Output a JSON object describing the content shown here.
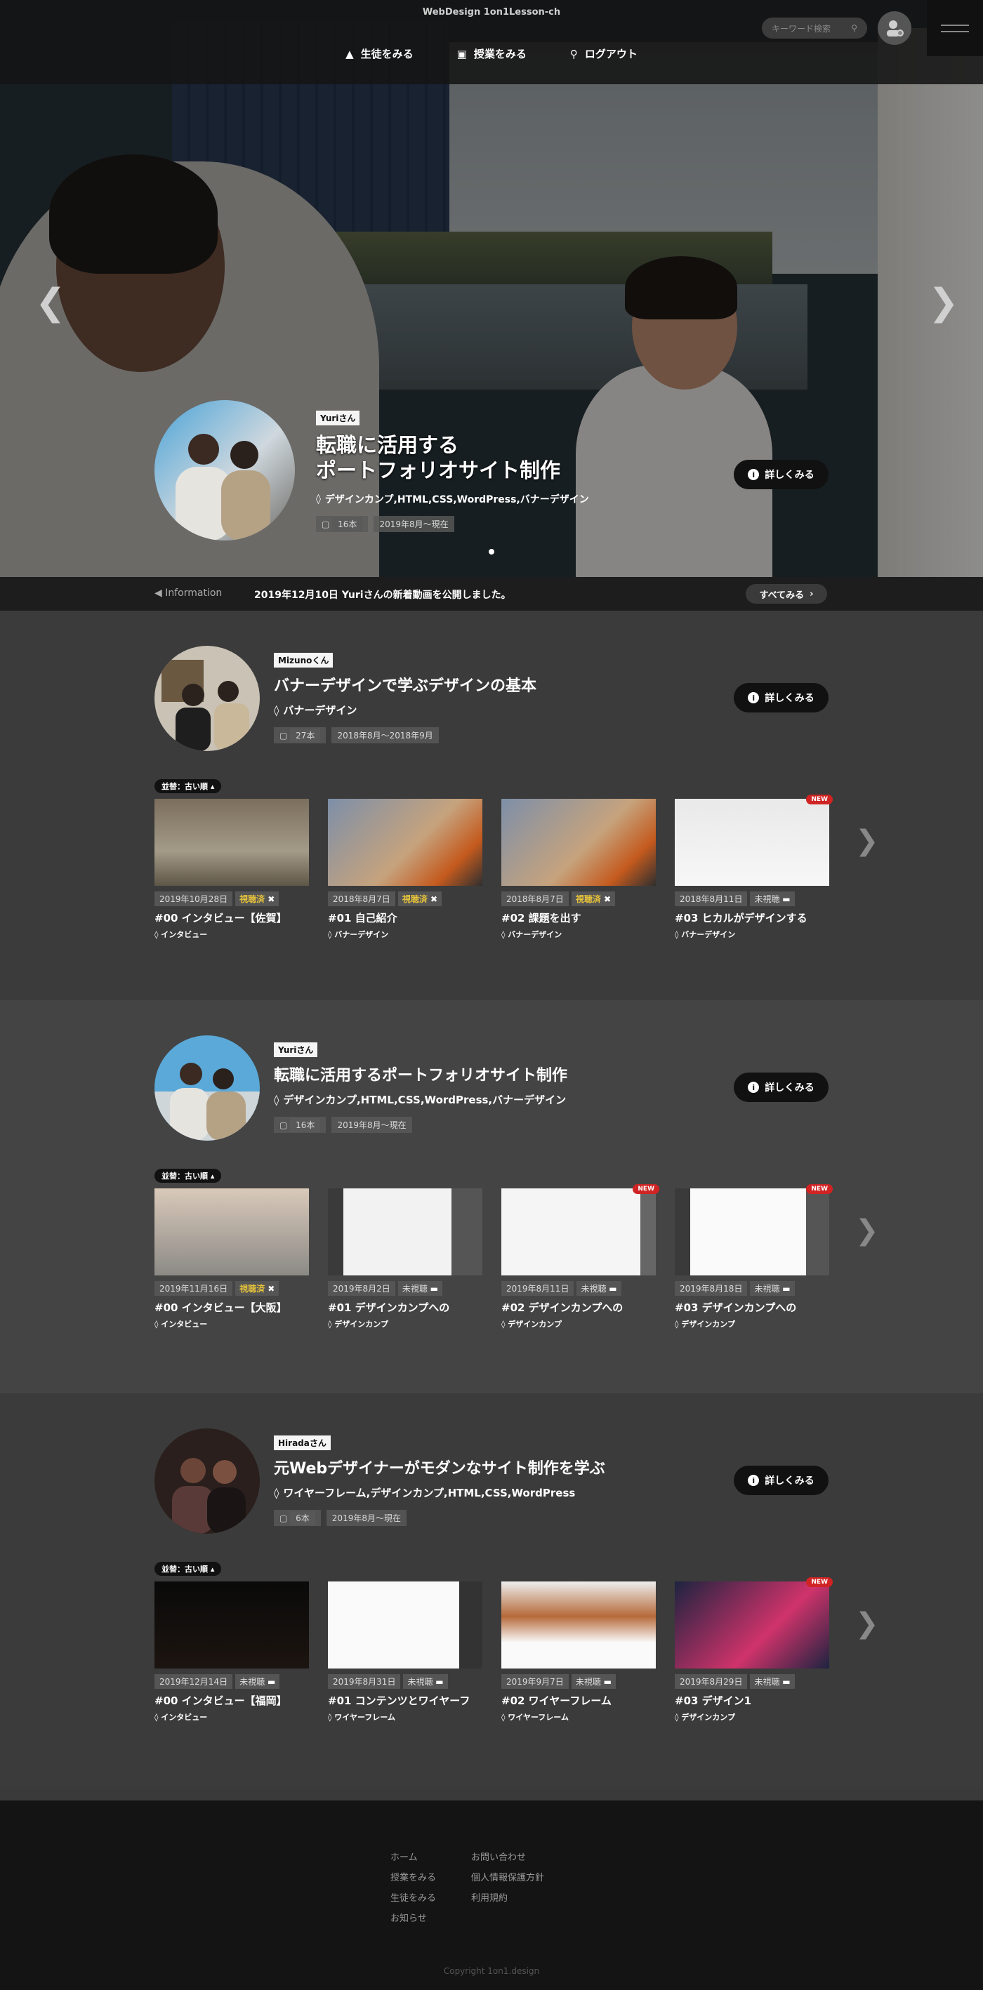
{
  "header": {
    "brand": "WebDesign 1on1Lesson-ch",
    "search_placeholder": "キーワード検索",
    "nav": [
      {
        "label": "生徒をみる",
        "icon": "graduation-cap-icon"
      },
      {
        "label": "授業をみる",
        "icon": "monitor-icon"
      },
      {
        "label": "ログアウト",
        "icon": "key-icon"
      }
    ]
  },
  "hero": {
    "name": "Yuriさん",
    "title_line1": "転職に活用する",
    "title_line2": "ポートフォリオサイト制作",
    "tags": "デザインカンプ,HTML,CSS,WordPress,バナーデザイン",
    "count": "16本",
    "period": "2019年8月〜現在",
    "detail": "詳しくみる"
  },
  "info": {
    "label": "Information",
    "message": "2019年12月10日 Yuriさんの新着動画を公開しました。",
    "all": "すべてみる"
  },
  "sections": [
    {
      "name": "Mizunoくん",
      "title": "バナーデザインで学ぶデザインの基本",
      "tags": "バナーデザイン",
      "count": "27本",
      "period": "2018年8月〜2018年9月",
      "detail": "詳しくみる",
      "sort": "並替：古い順",
      "cards": [
        {
          "date": "2019年10月28日",
          "status": "視聴済",
          "title": "#00 インタビュー【佐賀】",
          "tag": "インタビュー",
          "new": ""
        },
        {
          "date": "2018年8月7日",
          "status": "視聴済",
          "title": "#01 自己紹介",
          "tag": "バナーデザイン",
          "new": ""
        },
        {
          "date": "2018年8月7日",
          "status": "視聴済",
          "title": "#02 課題を出す",
          "tag": "バナーデザイン",
          "new": ""
        },
        {
          "date": "2018年8月11日",
          "status": "未視聴",
          "title": "#03 ヒカルがデザインする",
          "tag": "バナーデザイン",
          "new": "NEW"
        }
      ]
    },
    {
      "name": "Yuriさん",
      "title": "転職に活用するポートフォリオサイト制作",
      "tags": "デザインカンプ,HTML,CSS,WordPress,バナーデザイン",
      "count": "16本",
      "period": "2019年8月〜現在",
      "detail": "詳しくみる",
      "sort": "並替：古い順",
      "cards": [
        {
          "date": "2019年11月16日",
          "status": "視聴済",
          "title": "#00 インタビュー【大阪】",
          "tag": "インタビュー",
          "new": ""
        },
        {
          "date": "2019年8月2日",
          "status": "未視聴",
          "title": "#01 デザインカンプへの",
          "tag": "デザインカンプ",
          "new": ""
        },
        {
          "date": "2019年8月11日",
          "status": "未視聴",
          "title": "#02 デザインカンプへの",
          "tag": "デザインカンプ",
          "new": "NEW"
        },
        {
          "date": "2019年8月18日",
          "status": "未視聴",
          "title": "#03 デザインカンプへの",
          "tag": "デザインカンプ",
          "new": "NEW"
        }
      ]
    },
    {
      "name": "Hiradaさん",
      "title": "元Webデザイナーがモダンなサイト制作を学ぶ",
      "tags": "ワイヤーフレーム,デザインカンプ,HTML,CSS,WordPress",
      "count": "6本",
      "period": "2019年8月〜現在",
      "detail": "詳しくみる",
      "sort": "並替：古い順",
      "cards": [
        {
          "date": "2019年12月14日",
          "status": "未視聴",
          "title": "#00 インタビュー【福岡】",
          "tag": "インタビュー",
          "new": ""
        },
        {
          "date": "2019年8月31日",
          "status": "未視聴",
          "title": "#01 コンテンツとワイヤーフ",
          "tag": "ワイヤーフレーム",
          "new": ""
        },
        {
          "date": "2019年9月7日",
          "status": "未視聴",
          "title": "#02 ワイヤーフレーム",
          "tag": "ワイヤーフレーム",
          "new": ""
        },
        {
          "date": "2019年8月29日",
          "status": "未視聴",
          "title": "#03 デザイン1",
          "tag": "デザインカンプ",
          "new": "NEW"
        }
      ]
    }
  ],
  "footer": {
    "col1": [
      "ホーム",
      "授業をみる",
      "生徒をみる",
      "お知らせ"
    ],
    "col2": [
      "お問い合わせ",
      "個人情報保護方針",
      "利用規約"
    ],
    "copyright": "Copyright 1on1.design"
  }
}
